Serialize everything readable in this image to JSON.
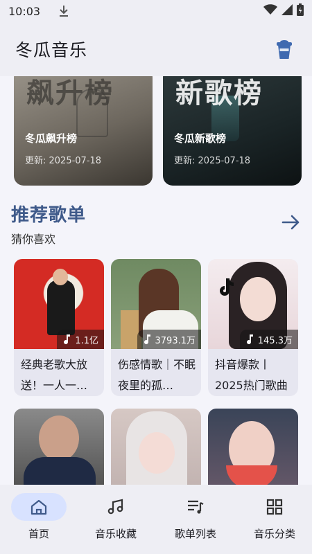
{
  "status_bar": {
    "time": "10:03"
  },
  "app_bar": {
    "title": "冬瓜音乐",
    "action_icon": "cup-icon"
  },
  "charts": [
    {
      "big_text": "飙升榜",
      "name": "冬瓜飙升榜",
      "date": "更新: 2025-07-18"
    },
    {
      "big_text": "新歌榜",
      "name": "冬瓜新歌榜",
      "date": "更新: 2025-07-18"
    }
  ],
  "recommend": {
    "title": "推荐歌单",
    "subtitle": "猜你喜欢",
    "playlists": [
      {
        "count": "1.1亿",
        "title": "经典老歌大放送！一人一…"
      },
      {
        "count": "3793.1万",
        "title": "伤感情歌｜不眠夜里的孤…"
      },
      {
        "count": "145.3万",
        "title": "抖音爆款丨2025热门歌曲"
      },
      {
        "count": "",
        "title": ""
      },
      {
        "count": "",
        "title": ""
      },
      {
        "count": "",
        "title": ""
      }
    ]
  },
  "bottom_nav": {
    "items": [
      {
        "label": "首页",
        "icon": "home-icon"
      },
      {
        "label": "音乐收藏",
        "icon": "music-note-icon"
      },
      {
        "label": "歌单列表",
        "icon": "playlist-icon"
      },
      {
        "label": "音乐分类",
        "icon": "grid-icon"
      }
    ]
  },
  "colors": {
    "accent": "#3f5a8a",
    "nav_active": "#d8e2ff",
    "background": "#f4f4fa"
  }
}
